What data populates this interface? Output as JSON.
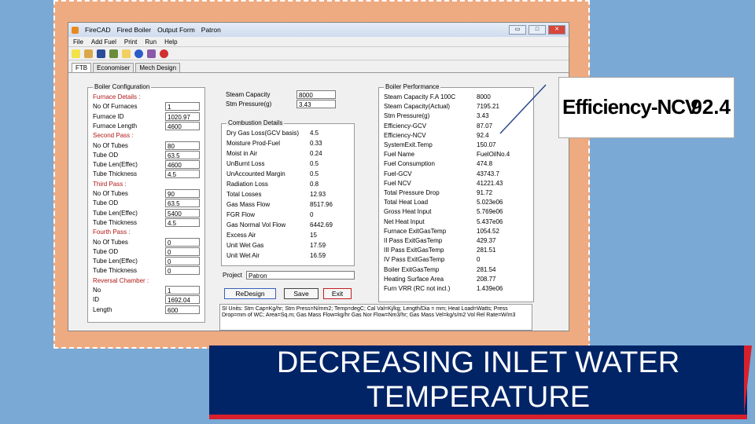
{
  "window": {
    "title_app": "FireCAD",
    "title_section": "Fired Boiler",
    "title_form": "Output Form",
    "title_user": "Patron",
    "controls": [
      "▭",
      "□",
      "✕"
    ]
  },
  "menu": [
    "File",
    "Add Fuel",
    "Print",
    "Run",
    "Help"
  ],
  "toolbar_icons": [
    "new-icon",
    "open-icon",
    "save-icon",
    "edit-icon",
    "bulb-icon",
    "add-icon",
    "tools-icon",
    "delete-icon"
  ],
  "tabs": [
    "FTB",
    "Economiser",
    "Mech Design"
  ],
  "boiler_config": {
    "title": "Boiler Configuration",
    "rows": [
      {
        "label": "Furnace Details :",
        "value": "",
        "red": true
      },
      {
        "label": "No Of Furnaces",
        "value": "1"
      },
      {
        "label": "Furnace ID",
        "value": "1020.97"
      },
      {
        "label": "Furnace Length",
        "value": "4600"
      },
      {
        "label": "Second Pass :",
        "value": "",
        "red": true
      },
      {
        "label": "No Of Tubes",
        "value": "80"
      },
      {
        "label": "Tube OD",
        "value": "63.5"
      },
      {
        "label": "Tube Len(Effec)",
        "value": "4600"
      },
      {
        "label": "Tube Thickness",
        "value": "4.5"
      },
      {
        "label": "Third Pass :",
        "value": "",
        "red": true
      },
      {
        "label": "No Of Tubes",
        "value": "90"
      },
      {
        "label": "Tube OD",
        "value": "63.5"
      },
      {
        "label": "Tube Len(Effec)",
        "value": "5400"
      },
      {
        "label": "Tube Thickness",
        "value": "4.5"
      },
      {
        "label": "Fourth Pass :",
        "value": "",
        "red": true
      },
      {
        "label": "No Of Tubes",
        "value": "0"
      },
      {
        "label": "Tube OD",
        "value": "0"
      },
      {
        "label": "Tube Len(Effec)",
        "value": "0"
      },
      {
        "label": "Tube Thickness",
        "value": "0"
      },
      {
        "label": "Reversal Chamber :",
        "value": "",
        "red": true
      },
      {
        "label": "No",
        "value": "1"
      },
      {
        "label": "ID",
        "value": "1692.04"
      },
      {
        "label": "Length",
        "value": "600"
      }
    ]
  },
  "steam": {
    "rows": [
      {
        "label": "Steam Capacity",
        "value": "8000"
      },
      {
        "label": "Stm Pressure(g)",
        "value": "3.43"
      }
    ]
  },
  "combustion": {
    "title": "Combustion Details",
    "rows": [
      {
        "label": "Dry Gas Loss(GCV basis)",
        "value": "4.5"
      },
      {
        "label": "Moisture Prod-Fuel",
        "value": "0.33"
      },
      {
        "label": "Moist in Air",
        "value": "0.24"
      },
      {
        "label": "UnBurnt Loss",
        "value": "0.5"
      },
      {
        "label": "UnAccounted Margin",
        "value": "0.5"
      },
      {
        "label": "Radiation Loss",
        "value": "0.8"
      },
      {
        "label": "Total Losses",
        "value": "12.93"
      },
      {
        "label": "Gas Mass Flow",
        "value": "8517.96"
      },
      {
        "label": "FGR Flow",
        "value": "0"
      },
      {
        "label": "Gas Normal Vol Flow",
        "value": "6442.69"
      },
      {
        "label": "Excess Air",
        "value": "15"
      },
      {
        "label": "Unit Wet Gas",
        "value": "17.59"
      },
      {
        "label": "Unit Wet Air",
        "value": "16.59"
      }
    ]
  },
  "project": {
    "label": "Project",
    "value": "Patron"
  },
  "buttons": {
    "redesign": "ReDesign",
    "save": "Save",
    "exit": "Exit"
  },
  "units_note": "SI Units: Stm Cap=Kg/hr; Stm Press=N/mm2; Temp=degC; Cal Val=Kj/kg; Length/Dia = mm; Heat Load=Watts; Press Drop=mm of WC; Area=Sq.m; Gas Mass Flow=kg/hr Gas Nor Flow=Nm3/hr; Gas Mass Vel=kg/s/m2 Vol Rel Rate=W/m3",
  "performance": {
    "title": "Boiler Performance",
    "rows": [
      {
        "label": "Steam Capacity F.A 100C",
        "value": "8000"
      },
      {
        "label": "Steam Capacity(Actual)",
        "value": "7195.21"
      },
      {
        "label": "Stm Pressure(g)",
        "value": "3.43"
      },
      {
        "label": "Efficiency-GCV",
        "value": "87.07"
      },
      {
        "label": "Efficiency-NCV",
        "value": "92.4"
      },
      {
        "label": "SystemExit.Temp",
        "value": "150.07"
      },
      {
        "label": "Fuel Name",
        "value": "FuelOilNo.4"
      },
      {
        "label": "Fuel Consumption",
        "value": "474.8"
      },
      {
        "label": "Fuel-GCV",
        "value": "43743.7"
      },
      {
        "label": "Fuel NCV",
        "value": "41221.43"
      },
      {
        "label": "Total Pressure Drop",
        "value": "91.72"
      },
      {
        "label": "Total Heat Load",
        "value": "5.023e06"
      },
      {
        "label": "Gross Heat Input",
        "value": "5.769e06"
      },
      {
        "label": "Net Heat Input",
        "value": "5.437e06"
      },
      {
        "label": "Furnace ExitGasTemp",
        "value": "1054.52"
      },
      {
        "label": "II Pass ExitGasTemp",
        "value": "429.37"
      },
      {
        "label": "III Pass ExitGasTemp",
        "value": "281.51"
      },
      {
        "label": "IV Pass ExitGasTemp",
        "value": "0"
      },
      {
        "label": "Boiler ExitGasTemp",
        "value": "281.54"
      },
      {
        "label": "Heating Surface Area",
        "value": "208.77"
      },
      {
        "label": "Furn VRR (RC not incl.)",
        "value": "1.439e06"
      }
    ]
  },
  "callout": {
    "label": "Efficiency-NCV",
    "value": "92.4"
  },
  "banner": {
    "line1": "DECREASING INLET WATER",
    "line2": "TEMPERATURE"
  },
  "colors": {
    "slide_bg": "#7aa9d6",
    "frame": "#eeaa80",
    "banner_bg": "#002466",
    "banner_accent": "#d8202c",
    "label_red": "#b01818"
  }
}
